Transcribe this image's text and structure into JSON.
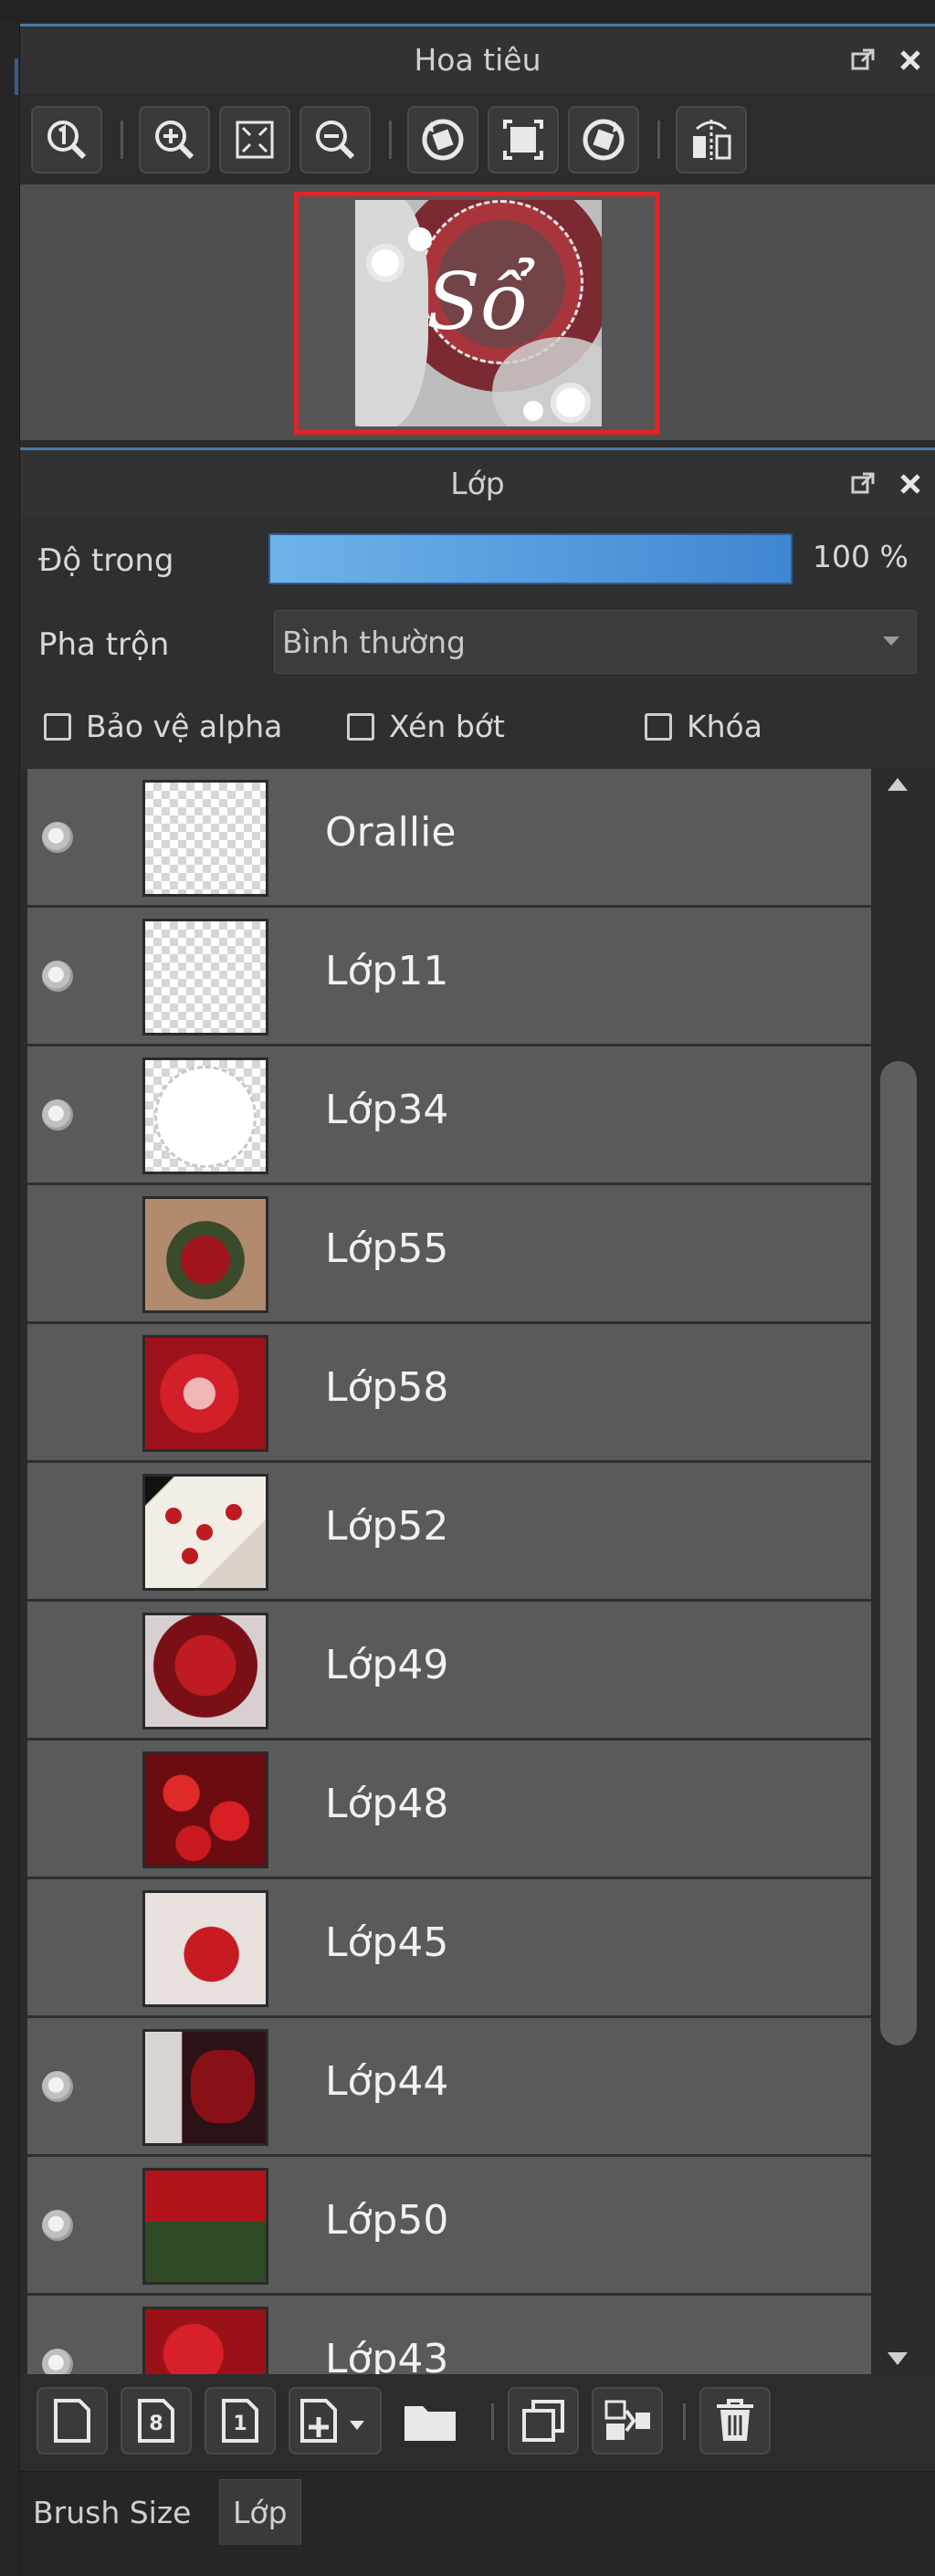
{
  "navigator": {
    "title": "Hoa tiêu",
    "toolbar": [
      "zoom-actual-icon",
      "zoom-in-icon",
      "fit-screen-icon",
      "zoom-out-icon",
      "rotate-left-icon",
      "fit-window-icon",
      "rotate-right-icon",
      "flip-horizontal-icon"
    ],
    "preview_text": "Sổ"
  },
  "layers_panel": {
    "title": "Lớp",
    "opacity_label": "Độ trong",
    "opacity_value": "100 %",
    "opacity_level": 1.0,
    "blend_label": "Pha trộn",
    "blend_value": "Bình thường",
    "checkboxes": [
      {
        "label": "Bảo vệ alpha",
        "checked": false
      },
      {
        "label": "Xén bớt",
        "checked": false
      },
      {
        "label": "Khóa",
        "checked": false
      }
    ],
    "layers": [
      {
        "name": "Orallie",
        "visible": true
      },
      {
        "name": "Lớp11",
        "visible": true
      },
      {
        "name": "Lớp34",
        "visible": true
      },
      {
        "name": "Lớp55",
        "visible": false
      },
      {
        "name": "Lớp58",
        "visible": false
      },
      {
        "name": "Lớp52",
        "visible": false
      },
      {
        "name": "Lớp49",
        "visible": false
      },
      {
        "name": "Lớp48",
        "visible": false
      },
      {
        "name": "Lớp45",
        "visible": false
      },
      {
        "name": "Lớp44",
        "visible": true
      },
      {
        "name": "Lớp50",
        "visible": true
      },
      {
        "name": "Lớp43",
        "visible": true
      }
    ],
    "bottom_toolbar": [
      "new-layer-icon",
      "new-8bit-layer-icon",
      "new-1bit-layer-icon",
      "add-layer-menu-icon",
      "folder-icon",
      "duplicate-layer-icon",
      "merge-layer-icon",
      "delete-layer-icon"
    ]
  },
  "tabs": [
    {
      "label": "Brush Size",
      "active": false
    },
    {
      "label": "Lớp",
      "active": true
    }
  ],
  "colors": {
    "accent": "#4d7aa6",
    "opacity_bar": "#4a95dc",
    "selection_frame": "#e0242a"
  }
}
